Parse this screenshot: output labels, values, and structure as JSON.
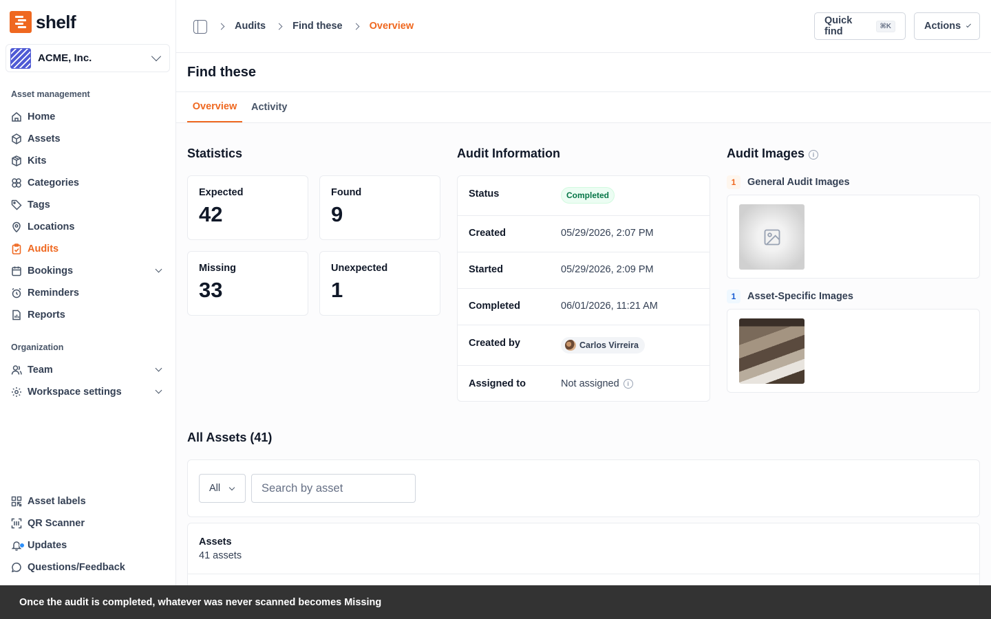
{
  "app": {
    "logo_text": "shelf"
  },
  "workspace": {
    "name": "ACME, Inc."
  },
  "sidebar": {
    "section_asset": "Asset management",
    "section_org": "Organization",
    "items": [
      {
        "label": "Home",
        "icon": "home-icon"
      },
      {
        "label": "Assets",
        "icon": "box-icon"
      },
      {
        "label": "Kits",
        "icon": "package-icon"
      },
      {
        "label": "Categories",
        "icon": "categories-icon"
      },
      {
        "label": "Tags",
        "icon": "tag-icon"
      },
      {
        "label": "Locations",
        "icon": "map-pin-icon"
      },
      {
        "label": "Audits",
        "icon": "clipboard-check-icon",
        "active": true
      },
      {
        "label": "Bookings",
        "icon": "calendar-icon"
      },
      {
        "label": "Reminders",
        "icon": "alarm-icon"
      },
      {
        "label": "Reports",
        "icon": "file-chart-icon"
      }
    ],
    "org_items": [
      {
        "label": "Team",
        "icon": "user-icon"
      },
      {
        "label": "Workspace settings",
        "icon": "gear-icon"
      }
    ],
    "bottom_items": [
      {
        "label": "Asset labels",
        "icon": "qr-code-icon"
      },
      {
        "label": "QR Scanner",
        "icon": "scan-icon"
      },
      {
        "label": "Updates",
        "icon": "bell-icon"
      },
      {
        "label": "Questions/Feedback",
        "icon": "message-circle-icon"
      }
    ]
  },
  "header": {
    "breadcrumbs": [
      "Audits",
      "Find these",
      "Overview"
    ],
    "quick_find_label": "Quick find",
    "quick_find_shortcut": "⌘K",
    "actions_label": "Actions"
  },
  "page": {
    "title": "Find these",
    "tabs": [
      "Overview",
      "Activity"
    ]
  },
  "statistics": {
    "title": "Statistics",
    "cards": [
      {
        "label": "Expected",
        "value": "42"
      },
      {
        "label": "Found",
        "value": "9"
      },
      {
        "label": "Missing",
        "value": "33"
      },
      {
        "label": "Unexpected",
        "value": "1"
      }
    ]
  },
  "audit_info": {
    "title": "Audit Information",
    "status_label": "Status",
    "status_value": "Completed",
    "status_color": "#067647",
    "created_label": "Created",
    "created_value": "05/29/2026, 2:07 PM",
    "started_label": "Started",
    "started_value": "05/29/2026, 2:09 PM",
    "completed_label": "Completed",
    "completed_value": "06/01/2026, 11:21 AM",
    "created_by_label": "Created by",
    "created_by_value": "Carlos Virreira",
    "assigned_label": "Assigned to",
    "assigned_value": "Not assigned"
  },
  "audit_images": {
    "title": "Audit Images",
    "general": {
      "count": "1",
      "label": "General Audit Images"
    },
    "asset_specific": {
      "count": "1",
      "label": "Asset-Specific Images"
    }
  },
  "all_assets": {
    "title": "All Assets (41)",
    "filter_value": "All",
    "search_placeholder": "Search by asset",
    "table_title": "Assets",
    "table_count": "41 assets"
  },
  "toast": {
    "message": "Once the audit is completed, whatever was never scanned becomes Missing"
  },
  "colors": {
    "accent": "#ef6820",
    "notification": "#2e90fa"
  }
}
